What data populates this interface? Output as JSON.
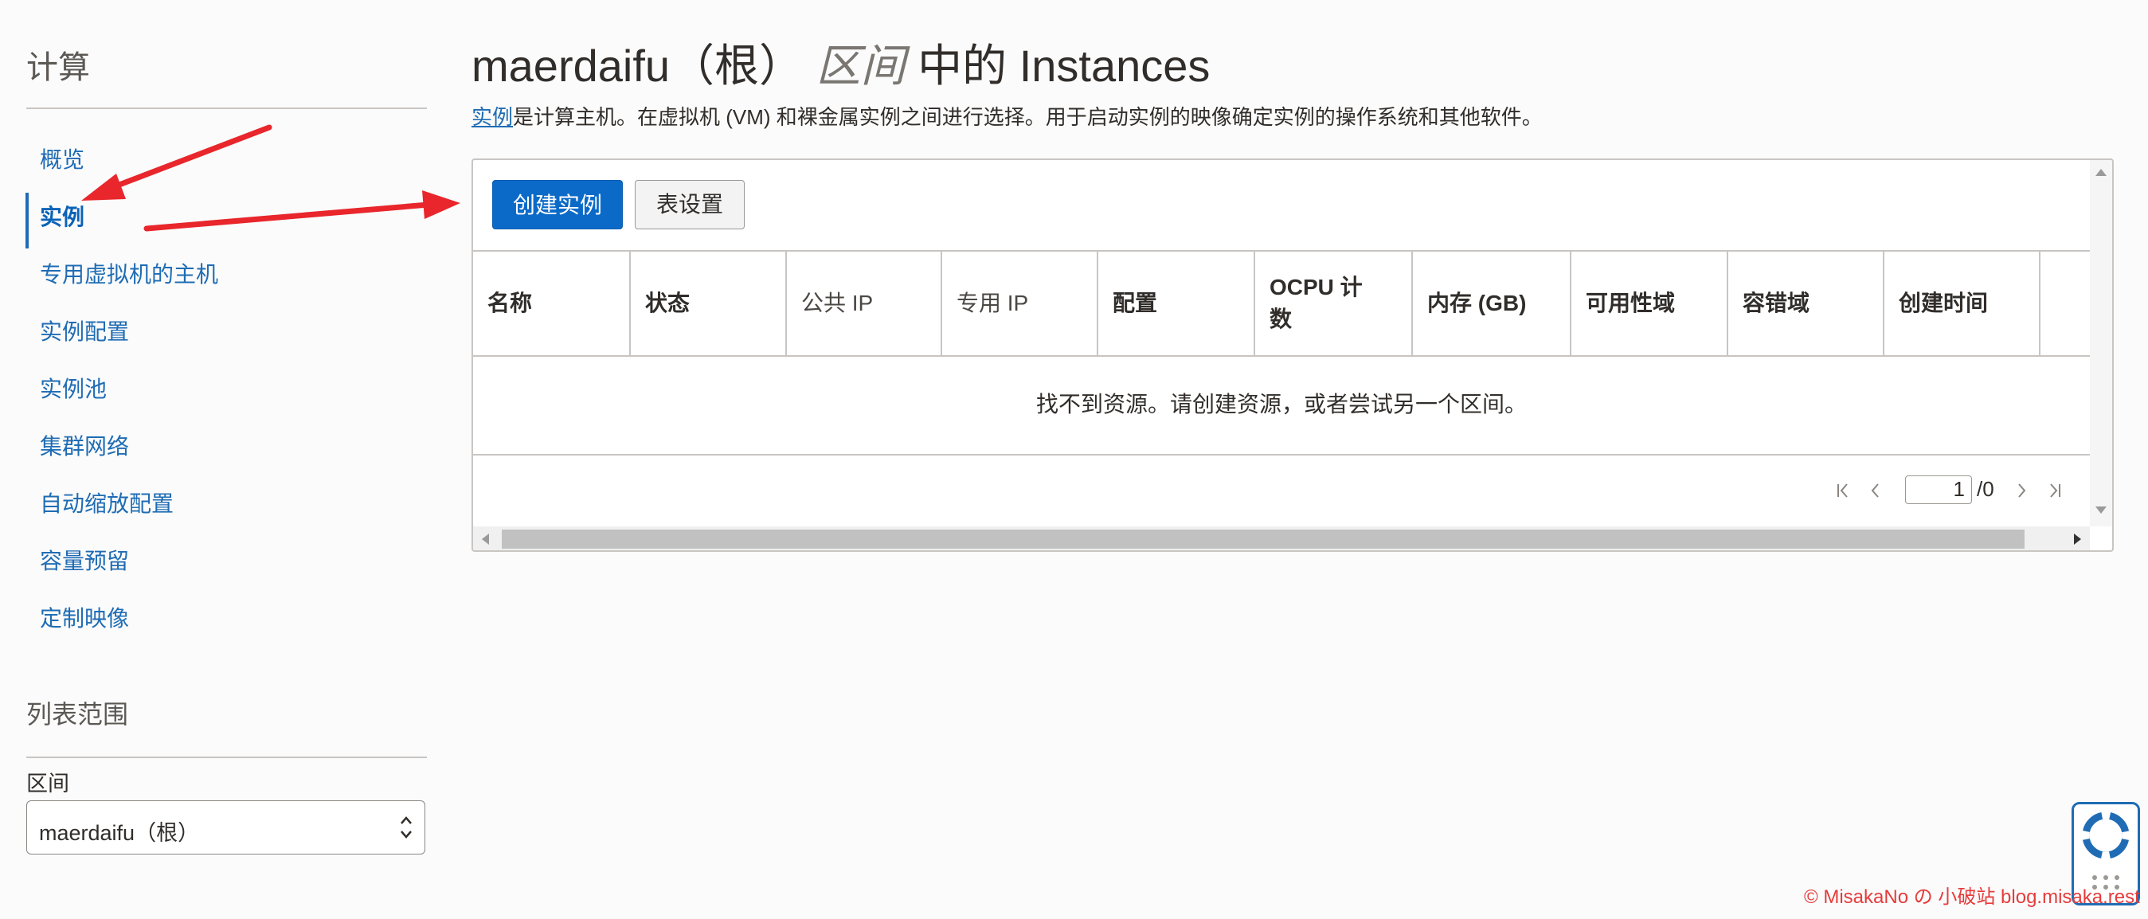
{
  "sidebar": {
    "title": "计算",
    "items": [
      {
        "label": "概览",
        "active": false
      },
      {
        "label": "实例",
        "active": true
      },
      {
        "label": "专用虚拟机的主机",
        "active": false
      },
      {
        "label": "实例配置",
        "active": false
      },
      {
        "label": "实例池",
        "active": false
      },
      {
        "label": "集群网络",
        "active": false
      },
      {
        "label": "自动缩放配置",
        "active": false
      },
      {
        "label": "容量预留",
        "active": false
      },
      {
        "label": "定制映像",
        "active": false
      }
    ],
    "scope": {
      "title": "列表范围",
      "compartment_label": "区间",
      "compartment_value": "maerdaifu（根）"
    }
  },
  "header": {
    "title_prefix": "maerdaifu（根）",
    "title_scope_word": "区间",
    "title_suffix": "中的 Instances",
    "description_link": "实例",
    "description_rest": "是计算主机。在虚拟机 (VM) 和裸金属实例之间进行选择。用于启动实例的映像确定实例的操作系统和其他软件。"
  },
  "toolbar": {
    "create_label": "创建实例",
    "settings_label": "表设置"
  },
  "table": {
    "columns": [
      {
        "label": "名称",
        "bold": true
      },
      {
        "label": "状态",
        "bold": true
      },
      {
        "label": "公共 IP",
        "bold": false
      },
      {
        "label": "专用 IP",
        "bold": false
      },
      {
        "label": "配置",
        "bold": true
      },
      {
        "label": "OCPU 计数",
        "bold": true
      },
      {
        "label": "内存 (GB)",
        "bold": true
      },
      {
        "label": "可用性域",
        "bold": true
      },
      {
        "label": "容错域",
        "bold": true
      },
      {
        "label": "创建时间",
        "bold": true
      }
    ],
    "empty_message": "找不到资源。请创建资源，或者尝试另一个区间。"
  },
  "pagination": {
    "current_page": "1",
    "total_label": "/0"
  },
  "watermark": "© MisakaNo の 小破站 blog.misaka.rest",
  "colors": {
    "accent": "#1f6cb4",
    "primary_button": "#0b6ac8",
    "annotation_arrow": "#e8262b",
    "watermark": "#e63b3b"
  }
}
